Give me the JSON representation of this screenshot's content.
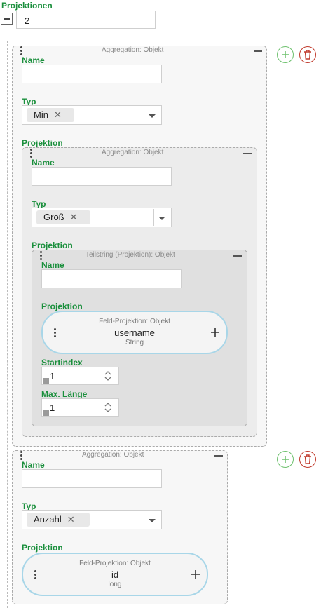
{
  "projektionen_label": "Projektionen",
  "projektionen_count": "2",
  "labels": {
    "name": "Name",
    "typ": "Typ",
    "projektion": "Projektion",
    "startindex": "Startindex",
    "max_laenge": "Max. Länge"
  },
  "block1": {
    "header": "Aggregation: Objekt",
    "typ_value": "Min",
    "inner": {
      "header": "Aggregation: Objekt",
      "typ_value": "Groß",
      "teilstring": {
        "header": "Teilstring (Projektion): Objekt",
        "field": {
          "header": "Feld-Projektion: Objekt",
          "name": "username",
          "type": "String"
        },
        "startindex": "1",
        "max_laenge": "1"
      }
    }
  },
  "block2": {
    "header": "Aggregation: Objekt",
    "typ_value": "Anzahl",
    "field": {
      "header": "Feld-Projektion: Objekt",
      "name": "id",
      "type": "long"
    }
  },
  "colors": {
    "label_green": "#1a8f3c",
    "add_green": "#6cc06c",
    "delete_red": "#c0392b",
    "pill_border": "#a8d6e8"
  },
  "icons": {
    "collapse": "minus-square-icon",
    "drag": "drag-handle-icon",
    "add": "plus-circle-icon",
    "delete": "trash-icon",
    "dropdown": "chevron-down-icon",
    "clear": "close-icon"
  }
}
